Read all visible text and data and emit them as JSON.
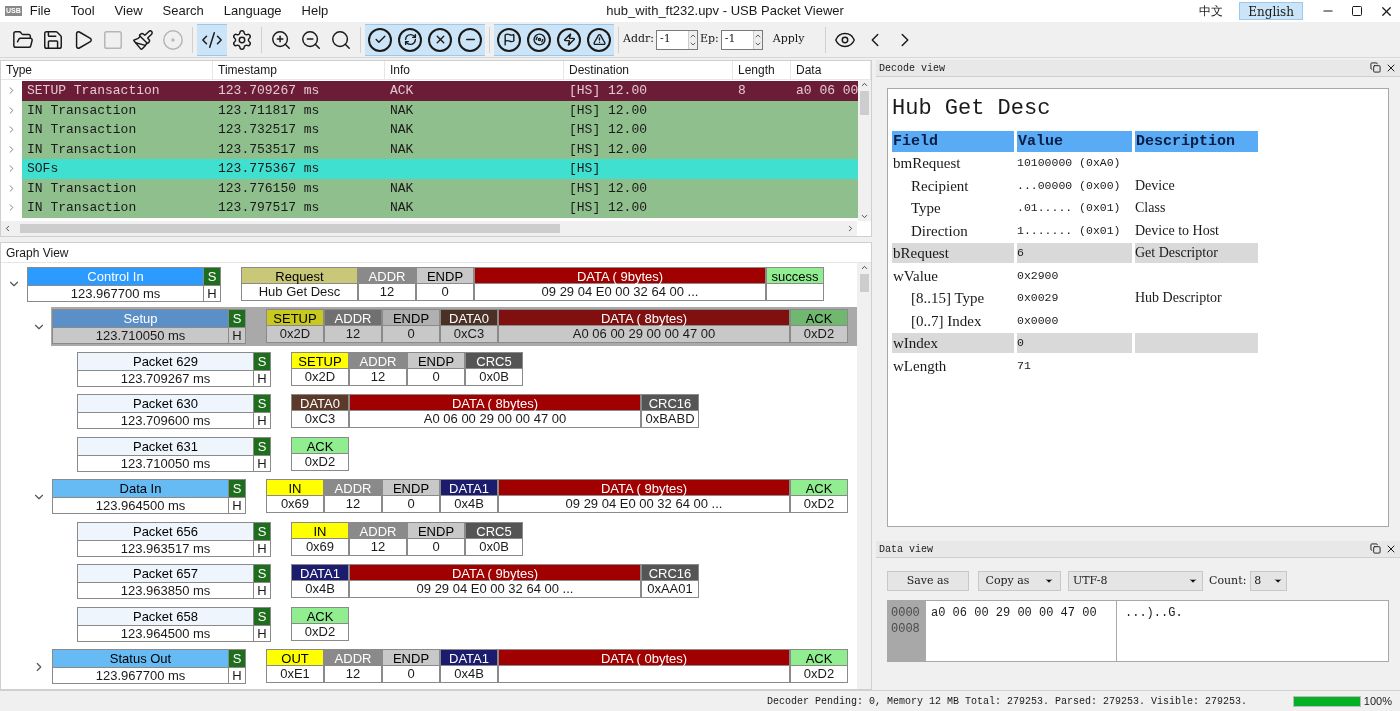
{
  "window": {
    "title": "hub_with_ft232.upv - USB Packet Viewer",
    "app_badge": "USB",
    "menus": [
      "File",
      "Tool",
      "View",
      "Search",
      "Language",
      "Help"
    ],
    "languages": [
      {
        "label": "中文",
        "selected": false
      },
      {
        "label": "English",
        "selected": true
      }
    ]
  },
  "toolbar": {
    "buttons": [
      {
        "kind": "open",
        "on": false,
        "disabled": false
      },
      {
        "kind": "save",
        "on": false,
        "disabled": false
      },
      {
        "kind": "play",
        "on": false,
        "disabled": false
      },
      {
        "kind": "stop",
        "on": false,
        "disabled": true
      },
      {
        "kind": "clean",
        "on": false,
        "disabled": false
      },
      {
        "kind": "record",
        "on": false,
        "disabled": true
      },
      {
        "kind": "separator"
      },
      {
        "kind": "code",
        "on": true,
        "disabled": false
      },
      {
        "kind": "settings",
        "on": false,
        "disabled": false
      },
      {
        "kind": "separator"
      },
      {
        "kind": "zoom_in",
        "on": false,
        "disabled": false
      },
      {
        "kind": "zoom_out",
        "on": false,
        "disabled": false
      },
      {
        "kind": "search",
        "on": false,
        "disabled": false
      },
      {
        "kind": "separator"
      },
      {
        "kind": "check",
        "on": true,
        "disabled": false
      },
      {
        "kind": "retry",
        "on": true,
        "disabled": false
      },
      {
        "kind": "cross",
        "on": true,
        "disabled": false
      },
      {
        "kind": "minus",
        "on": true,
        "disabled": false
      },
      {
        "kind": "separator"
      },
      {
        "kind": "flag",
        "on": true,
        "disabled": false
      },
      {
        "kind": "spiral",
        "on": true,
        "disabled": false
      },
      {
        "kind": "bolt",
        "on": true,
        "disabled": false
      },
      {
        "kind": "warning",
        "on": true,
        "disabled": false
      }
    ],
    "addr_label": "Addr:",
    "addr_value": "-1",
    "ep_label": "Ep:",
    "ep_value": "-1",
    "apply": "Apply"
  },
  "packet_list": {
    "columns": [
      "Type",
      "Timestamp",
      "Info",
      "Destination",
      "Length",
      "Data"
    ],
    "rows": [
      {
        "type": "SETUP Transaction",
        "timestamp": "123.709267 ms",
        "info": "ACK",
        "destination": "[HS] 12.00",
        "length": "8",
        "data": "a0 06 00",
        "color": "#6b1d37",
        "expanded": false
      },
      {
        "type": "IN Transaction",
        "timestamp": "123.711817 ms",
        "info": "NAK",
        "destination": "[HS] 12.00",
        "color": "#8fbf8c",
        "expanded": false
      },
      {
        "type": "IN Transaction",
        "timestamp": "123.732517 ms",
        "info": "NAK",
        "destination": "[HS] 12.00",
        "color": "#8fbf8c",
        "expanded": false
      },
      {
        "type": "IN Transaction",
        "timestamp": "123.753517 ms",
        "info": "NAK",
        "destination": "[HS] 12.00",
        "color": "#8fbf8c",
        "expanded": false
      },
      {
        "type": "SOFs",
        "timestamp": "123.775367 ms",
        "destination": "[HS]",
        "color": "#40e0d0",
        "expanded": false
      },
      {
        "type": "IN Transaction",
        "timestamp": "123.776150 ms",
        "info": "NAK",
        "destination": "[HS] 12.00",
        "color": "#8fbf8c",
        "expanded": false
      },
      {
        "type": "IN Transaction",
        "timestamp": "123.797517 ms",
        "info": "NAK",
        "destination": "[HS] 12.00",
        "color": "#8fbf8c",
        "expanded": false
      }
    ]
  },
  "graph_view": {
    "title": "Graph View",
    "items": [
      {
        "name": "Control In",
        "time": "123.967700 ms",
        "color": "#2b9bff",
        "flag_top": "S",
        "flag_bottom": "H",
        "expanded": true,
        "selected": false,
        "fields": [
          {
            "kind": "request",
            "label": "Request",
            "value": "Hub Get Desc",
            "color": "#c8c878"
          },
          {
            "kind": "addr",
            "label": "ADDR",
            "value": "12",
            "color": "#8a8a8a"
          },
          {
            "kind": "endp",
            "label": "ENDP",
            "value": "0",
            "color": "#c8c8c8"
          },
          {
            "kind": "data",
            "label": "DATA ( 9bytes)",
            "value": "09 29 04 E0 00 32 64 00 ...",
            "color": "#a00000"
          },
          {
            "kind": "status",
            "label": "success",
            "color": "#90ee90"
          }
        ],
        "children": [
          {
            "name": "Setup",
            "time": "123.710050 ms",
            "color": "#5b8fc7",
            "flag_top": "S",
            "flag_bottom": "H",
            "expanded": true,
            "selected": true,
            "fields": [
              {
                "kind": "pid",
                "label": "SETUP",
                "value": "0x2D",
                "color": "#c8c81e"
              },
              {
                "kind": "addr",
                "label": "ADDR",
                "value": "12",
                "color": "#707070"
              },
              {
                "kind": "endp",
                "label": "ENDP",
                "value": "0",
                "color": "#b0b0b0"
              },
              {
                "kind": "pid",
                "label": "DATA0",
                "value": "0xC3",
                "color": "#4a3025"
              },
              {
                "kind": "data",
                "label": "DATA ( 8bytes)",
                "value": "A0 06 00 29 00 00 47 00",
                "color": "#801010"
              },
              {
                "kind": "status",
                "label": "ACK",
                "value": "0xD2",
                "color": "#70b870"
              }
            ],
            "children": [
              {
                "name": "Packet 629",
                "time": "123.709267 ms",
                "color": "#eef5fd",
                "flag_top": "S",
                "flag_bottom": "H",
                "selected": false,
                "fields": [
                  {
                    "kind": "pid",
                    "label": "SETUP",
                    "value": "0x2D",
                    "color": "#ffff00"
                  },
                  {
                    "kind": "addr",
                    "label": "ADDR",
                    "value": "12",
                    "color": "#8a8a8a"
                  },
                  {
                    "kind": "endp",
                    "label": "ENDP",
                    "value": "0",
                    "color": "#c8c8c8"
                  },
                  {
                    "kind": "crc",
                    "label": "CRC5",
                    "value": "0x0B",
                    "color": "#555555"
                  }
                ]
              },
              {
                "name": "Packet 630",
                "time": "123.709600 ms",
                "color": "#eef5fd",
                "flag_top": "S",
                "flag_bottom": "H",
                "selected": false,
                "fields": [
                  {
                    "kind": "pid",
                    "label": "DATA0",
                    "value": "0xC3",
                    "color": "#5c3a2a"
                  },
                  {
                    "kind": "data",
                    "label": "DATA ( 8bytes)",
                    "value": "A0 06 00 29 00 00 47 00",
                    "color": "#a00000"
                  },
                  {
                    "kind": "crc",
                    "label": "CRC16",
                    "value": "0xBABD",
                    "color": "#555555"
                  }
                ]
              },
              {
                "name": "Packet 631",
                "time": "123.710050 ms",
                "color": "#eef5fd",
                "flag_top": "S",
                "flag_bottom": "H",
                "selected": false,
                "fields": [
                  {
                    "kind": "status",
                    "label": "ACK",
                    "value": "0xD2",
                    "color": "#90ee90"
                  }
                ]
              }
            ]
          },
          {
            "name": "Data In",
            "time": "123.964500 ms",
            "color": "#66bbf5",
            "flag_top": "S",
            "flag_bottom": "H",
            "expanded": true,
            "selected": false,
            "fields": [
              {
                "kind": "pid",
                "label": "IN",
                "value": "0x69",
                "color": "#ffff00"
              },
              {
                "kind": "addr",
                "label": "ADDR",
                "value": "12",
                "color": "#8a8a8a"
              },
              {
                "kind": "endp",
                "label": "ENDP",
                "value": "0",
                "color": "#c8c8c8"
              },
              {
                "kind": "pid",
                "label": "DATA1",
                "value": "0x4B",
                "color": "#1c1c6e"
              },
              {
                "kind": "data",
                "label": "DATA ( 9bytes)",
                "value": "09 29 04 E0 00 32 64 00 ...",
                "color": "#a00000"
              },
              {
                "kind": "status",
                "label": "ACK",
                "value": "0xD2",
                "color": "#90ee90"
              }
            ],
            "children": [
              {
                "name": "Packet 656",
                "time": "123.963517 ms",
                "color": "#eef5fd",
                "flag_top": "S",
                "flag_bottom": "H",
                "selected": false,
                "fields": [
                  {
                    "kind": "pid",
                    "label": "IN",
                    "value": "0x69",
                    "color": "#ffff00"
                  },
                  {
                    "kind": "addr",
                    "label": "ADDR",
                    "value": "12",
                    "color": "#8a8a8a"
                  },
                  {
                    "kind": "endp",
                    "label": "ENDP",
                    "value": "0",
                    "color": "#c8c8c8"
                  },
                  {
                    "kind": "crc",
                    "label": "CRC5",
                    "value": "0x0B",
                    "color": "#555555"
                  }
                ]
              },
              {
                "name": "Packet 657",
                "time": "123.963850 ms",
                "color": "#eef5fd",
                "flag_top": "S",
                "flag_bottom": "H",
                "selected": false,
                "fields": [
                  {
                    "kind": "pid",
                    "label": "DATA1",
                    "value": "0x4B",
                    "color": "#1c1c6e"
                  },
                  {
                    "kind": "data",
                    "label": "DATA ( 9bytes)",
                    "value": "09 29 04 E0 00 32 64 00 ...",
                    "color": "#a00000"
                  },
                  {
                    "kind": "crc",
                    "label": "CRC16",
                    "value": "0xAA01",
                    "color": "#555555"
                  }
                ]
              },
              {
                "name": "Packet 658",
                "time": "123.964500 ms",
                "color": "#eef5fd",
                "flag_top": "S",
                "flag_bottom": "H",
                "selected": false,
                "fields": [
                  {
                    "kind": "status",
                    "label": "ACK",
                    "value": "0xD2",
                    "color": "#90ee90"
                  }
                ]
              }
            ]
          },
          {
            "name": "Status Out",
            "time": "123.967700 ms",
            "color": "#66bbf5",
            "flag_top": "S",
            "flag_bottom": "H",
            "expanded": false,
            "selected": false,
            "fields": [
              {
                "kind": "pid",
                "label": "OUT",
                "value": "0xE1",
                "color": "#ffff00"
              },
              {
                "kind": "addr",
                "label": "ADDR",
                "value": "12",
                "color": "#8a8a8a"
              },
              {
                "kind": "endp",
                "label": "ENDP",
                "value": "0",
                "color": "#c8c8c8"
              },
              {
                "kind": "pid",
                "label": "DATA1",
                "value": "0x4B",
                "color": "#1c1c6e"
              },
              {
                "kind": "data",
                "label": "DATA ( 0bytes)",
                "color": "#a00000"
              },
              {
                "kind": "status",
                "label": "ACK",
                "value": "0xD2",
                "color": "#90ee90"
              }
            ]
          }
        ]
      }
    ]
  },
  "decode_view": {
    "title": "Decode view",
    "heading": "Hub Get Desc",
    "columns": [
      "Field",
      "Value",
      "Description"
    ],
    "rows": [
      {
        "field": "bmRequest",
        "value": "10100000 (0xA0)",
        "shaded": false,
        "children": [
          {
            "field": "Recipient",
            "value": "...00000 (0x00)",
            "description": "Device",
            "shaded": false
          },
          {
            "field": "Type",
            "value": ".01..... (0x01)",
            "description": "Class",
            "shaded": false
          },
          {
            "field": "Direction",
            "value": "1....... (0x01)",
            "description": "Device to Host",
            "shaded": false
          }
        ]
      },
      {
        "field": "bRequest",
        "value": "6",
        "description": "Get Descriptor",
        "shaded": true
      },
      {
        "field": "wValue",
        "value": "0x2900",
        "shaded": false,
        "children": [
          {
            "field": "[8..15] Type",
            "value": "0x0029",
            "description": "Hub Descriptor",
            "shaded": false
          },
          {
            "field": "[0..7] Index",
            "value": "0x0000",
            "shaded": false
          }
        ]
      },
      {
        "field": "wIndex",
        "value": "0",
        "shaded": true
      },
      {
        "field": "wLength",
        "value": "71",
        "shaded": false
      }
    ]
  },
  "data_view": {
    "title": "Data view",
    "save_button": "Save as",
    "copy_button": "Copy as",
    "encoding": "UTF-8",
    "count_label": "Count:",
    "count": "8",
    "offsets": [
      "0000",
      "0008"
    ],
    "hex_lines": [
      "a0 06 00 29 00 00 47 00"
    ],
    "ascii_lines": [
      "...)..G."
    ]
  },
  "status_bar": {
    "text": "Decoder Pending: 0, Memory 12 MB Total: 279253. Parsed: 279253. Visible: 279253.",
    "progress": {
      "level": 1.0,
      "label": "100%"
    }
  }
}
